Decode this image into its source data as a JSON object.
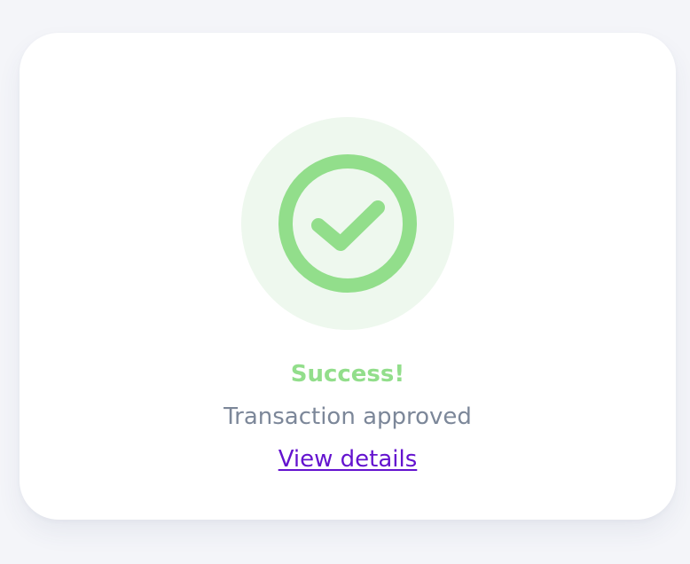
{
  "status": {
    "icon": "check-circle-icon",
    "title": "Success!",
    "message": "Transaction approved",
    "link_label": "View details"
  },
  "colors": {
    "success": "#92de8b",
    "success_halo": "#eef8ee",
    "message": "#7c8799",
    "link": "#6413cf",
    "page_background": "#f4f5f9",
    "card_background": "#ffffff"
  }
}
